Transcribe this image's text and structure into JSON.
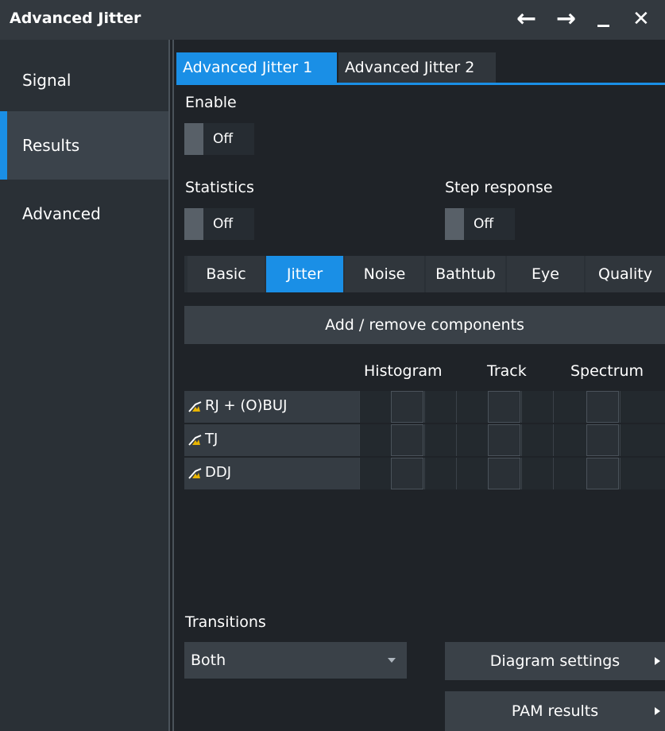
{
  "window": {
    "title": "Advanced Jitter",
    "controls": {
      "back": "←",
      "forward": "→",
      "minimize": "_",
      "close": "✕"
    }
  },
  "sidebar": {
    "items": [
      {
        "label": "Signal",
        "active": false
      },
      {
        "label": "Results",
        "active": true
      },
      {
        "label": "Advanced",
        "active": false
      }
    ]
  },
  "tabs": [
    {
      "label": "Advanced Jitter 1",
      "active": true
    },
    {
      "label": "Advanced Jitter 2",
      "active": false
    }
  ],
  "enable": {
    "label": "Enable",
    "value": "Off"
  },
  "statistics": {
    "label": "Statistics",
    "value": "Off"
  },
  "step_response": {
    "label": "Step response",
    "value": "Off"
  },
  "subtabs": [
    {
      "label": "Basic",
      "active": false
    },
    {
      "label": "Jitter",
      "active": true
    },
    {
      "label": "Noise",
      "active": false
    },
    {
      "label": "Bathtub",
      "active": false
    },
    {
      "label": "Eye",
      "active": false
    },
    {
      "label": "Quality",
      "active": false
    }
  ],
  "add_remove_button": "Add / remove components",
  "table": {
    "columns": [
      "Histogram",
      "Track",
      "Spectrum"
    ],
    "rows": [
      {
        "name": "RJ + (O)BUJ",
        "icon": "jitter-component-icon"
      },
      {
        "name": "TJ",
        "icon": "jitter-component-icon"
      },
      {
        "name": "DDJ",
        "icon": "jitter-component-icon"
      }
    ]
  },
  "transitions": {
    "label": "Transitions",
    "value": "Both"
  },
  "diagram_settings_button": "Diagram settings",
  "pam_results_button": "PAM results",
  "colors": {
    "accent": "#1a8fe6",
    "icon_yellow": "#e8b400"
  }
}
